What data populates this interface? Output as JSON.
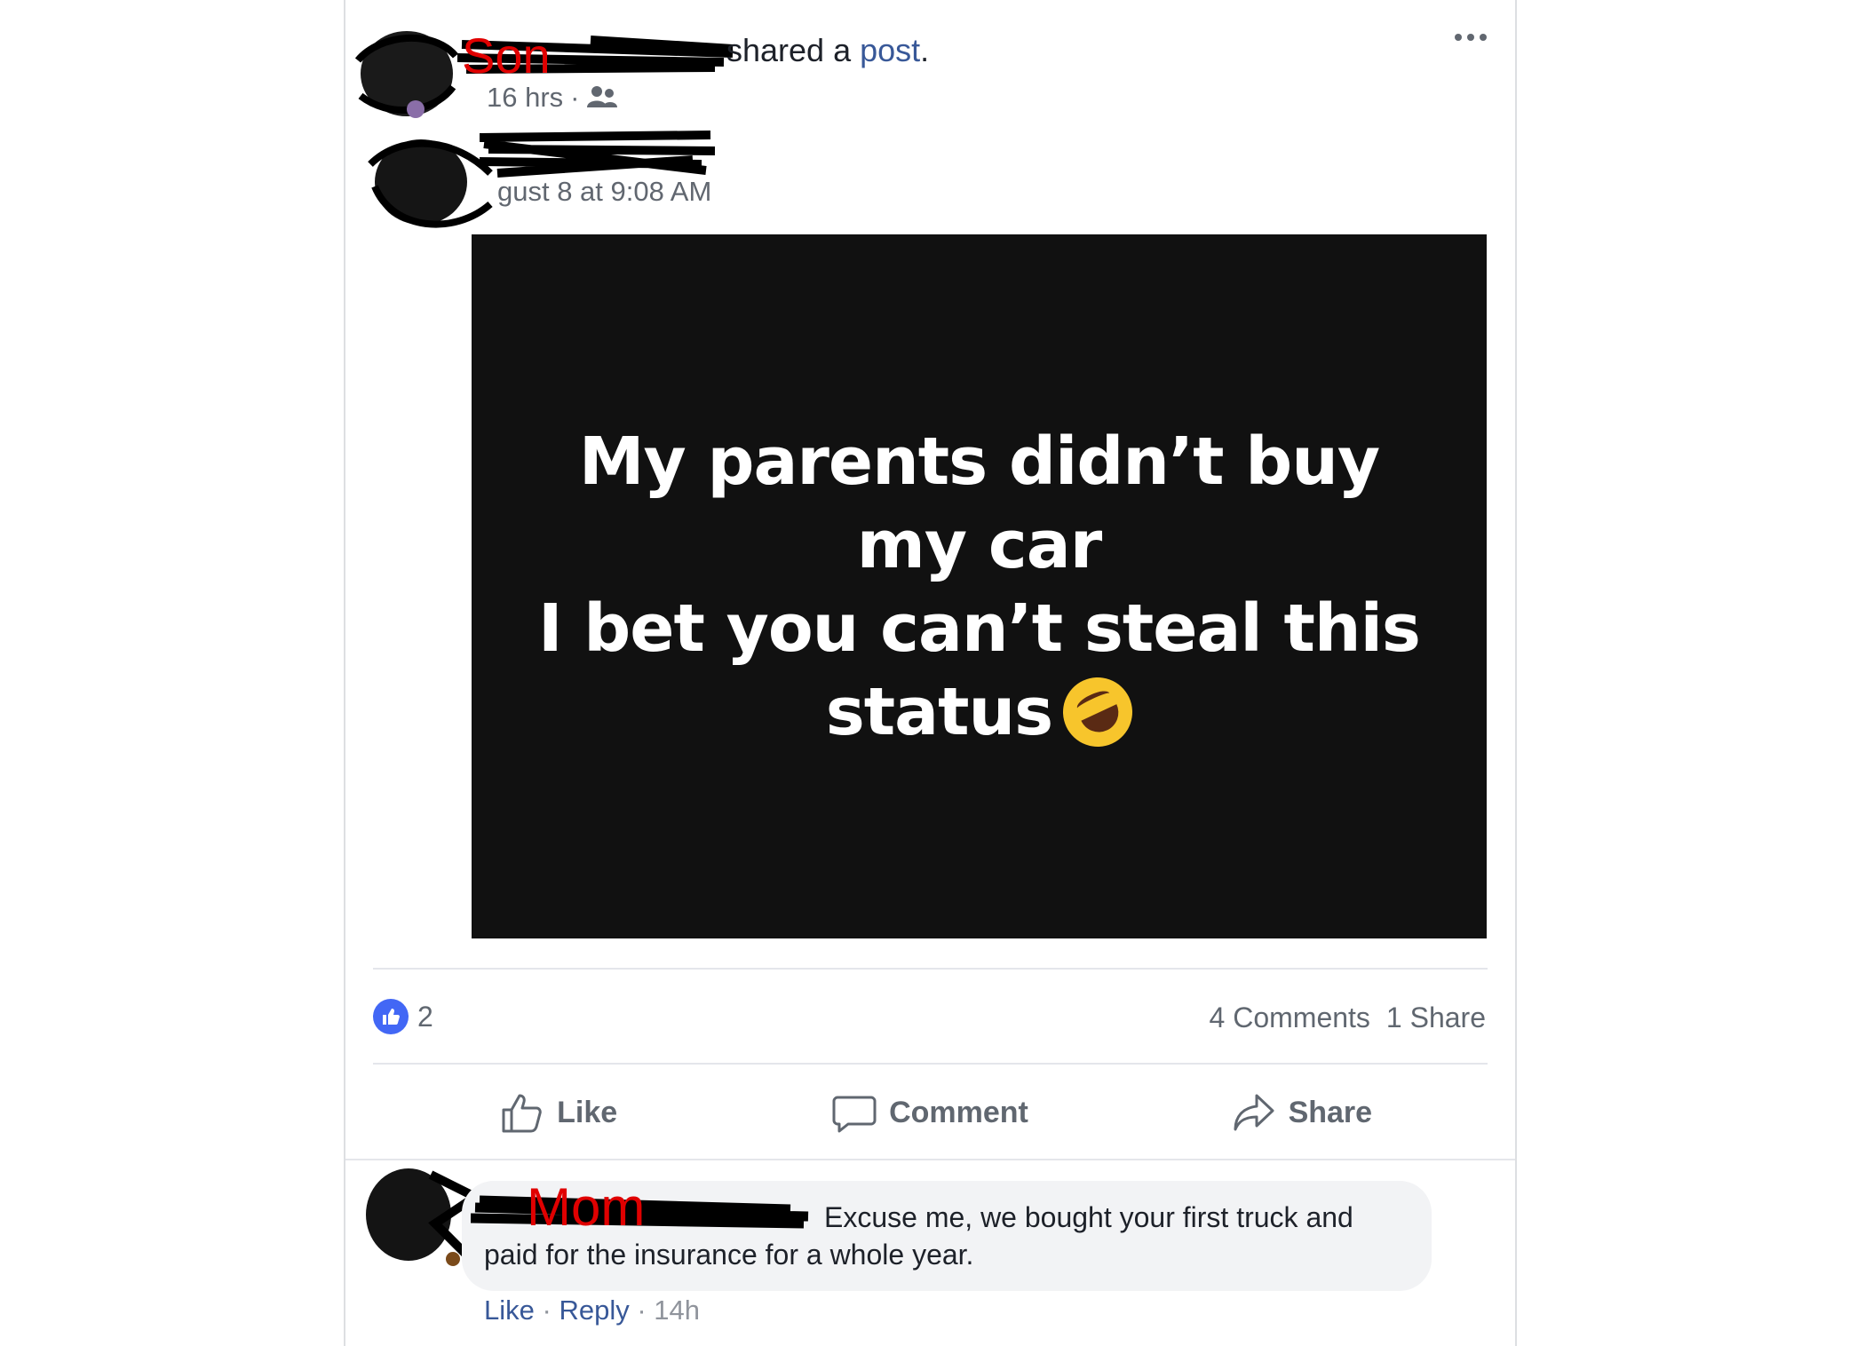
{
  "post": {
    "annotation_top": "Son",
    "shared_text": "shared a",
    "shared_link": "post",
    "shared_end": ".",
    "time": "16 hrs",
    "separator": "·",
    "original_date": "gust 8 at 9:08 AM",
    "status_lines": [
      "My parents didn’t buy my car",
      "I bet you can’t steal this",
      "status"
    ],
    "emoji_name": "rolling-on-floor-laughing-emoji"
  },
  "stats": {
    "like_count": "2",
    "comments": "4 Comments",
    "shares": "1 Share"
  },
  "actions": {
    "like": "Like",
    "comment": "Comment",
    "share": "Share"
  },
  "comment": {
    "annotation": "Mom",
    "text": "Excuse me, we bought your first truck and paid for the insurance for a whole year.",
    "like": "Like",
    "reply": "Reply",
    "dot": "·",
    "time": "14h"
  },
  "colors": {
    "link": "#385898",
    "like_blue": "#4267f5",
    "annotation_red": "#e00000",
    "status_bg": "#111111"
  }
}
